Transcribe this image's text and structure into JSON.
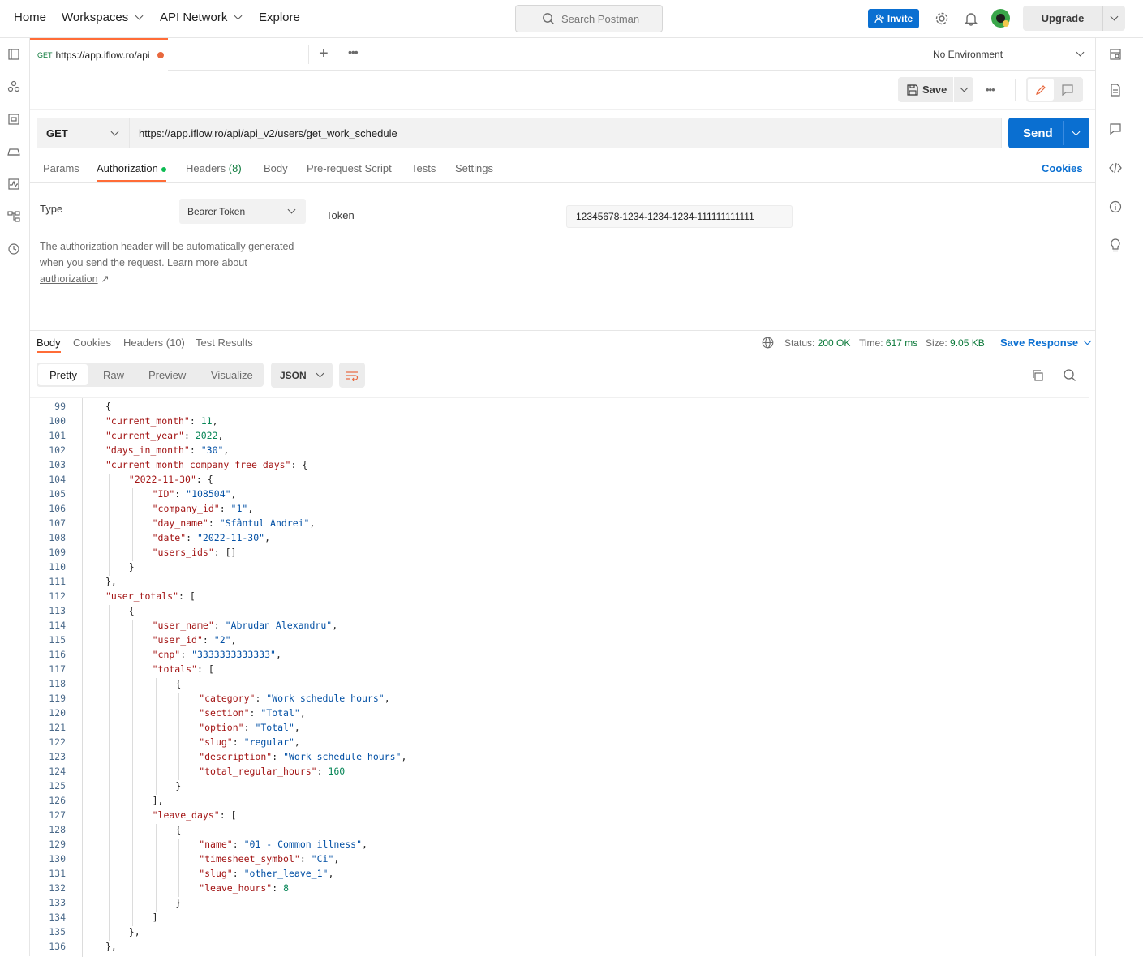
{
  "nav": {
    "home": "Home",
    "workspaces": "Workspaces",
    "api_network": "API Network",
    "explore": "Explore",
    "search_placeholder": "Search Postman",
    "invite": "Invite",
    "upgrade": "Upgrade"
  },
  "tab": {
    "method": "GET",
    "title": "https://app.iflow.ro/api",
    "environment": "No Environment"
  },
  "toolbar": {
    "save": "Save"
  },
  "request": {
    "method": "GET",
    "url": "https://app.iflow.ro/api/api_v2/users/get_work_schedule",
    "send": "Send"
  },
  "request_tabs": {
    "params": "Params",
    "authorization": "Authorization",
    "headers": "Headers",
    "headers_count": "(8)",
    "body": "Body",
    "pre_request": "Pre-request Script",
    "tests": "Tests",
    "settings": "Settings",
    "cookies": "Cookies"
  },
  "auth": {
    "type_label": "Type",
    "type_value": "Bearer Token",
    "description": "The authorization header will be automatically generated when you send the request. Learn more about",
    "link": "authorization",
    "arrow": "↗",
    "token_label": "Token",
    "token_value": "12345678-1234-1234-1234-111111111111"
  },
  "response_tabs": {
    "body": "Body",
    "cookies": "Cookies",
    "headers": "Headers",
    "headers_count": "(10)",
    "test_results": "Test Results"
  },
  "response_meta": {
    "status_label": "Status:",
    "status_value": "200 OK",
    "time_label": "Time:",
    "time_value": "617 ms",
    "size_label": "Size:",
    "size_value": "9.05 KB",
    "save_response": "Save Response"
  },
  "view_modes": {
    "pretty": "Pretty",
    "raw": "Raw",
    "preview": "Preview",
    "visualize": "Visualize",
    "format": "JSON"
  },
  "code_lines": [
    {
      "n": "99",
      "i": 1,
      "t": [
        [
          "p",
          "{"
        ]
      ]
    },
    {
      "n": "100",
      "i": 1,
      "t": [
        [
          "k",
          "\"current_month\""
        ],
        [
          "p",
          ": "
        ],
        [
          "n",
          "11"
        ],
        [
          "p",
          ","
        ]
      ]
    },
    {
      "n": "101",
      "i": 1,
      "t": [
        [
          "k",
          "\"current_year\""
        ],
        [
          "p",
          ": "
        ],
        [
          "n",
          "2022"
        ],
        [
          "p",
          ","
        ]
      ]
    },
    {
      "n": "102",
      "i": 1,
      "t": [
        [
          "k",
          "\"days_in_month\""
        ],
        [
          "p",
          ": "
        ],
        [
          "s",
          "\"30\""
        ],
        [
          "p",
          ","
        ]
      ]
    },
    {
      "n": "103",
      "i": 1,
      "t": [
        [
          "k",
          "\"current_month_company_free_days\""
        ],
        [
          "p",
          ": {"
        ]
      ]
    },
    {
      "n": "104",
      "i": 2,
      "t": [
        [
          "k",
          "\"2022-11-30\""
        ],
        [
          "p",
          ": {"
        ]
      ]
    },
    {
      "n": "105",
      "i": 3,
      "t": [
        [
          "k",
          "\"ID\""
        ],
        [
          "p",
          ": "
        ],
        [
          "s",
          "\"108504\""
        ],
        [
          "p",
          ","
        ]
      ]
    },
    {
      "n": "106",
      "i": 3,
      "t": [
        [
          "k",
          "\"company_id\""
        ],
        [
          "p",
          ": "
        ],
        [
          "s",
          "\"1\""
        ],
        [
          "p",
          ","
        ]
      ]
    },
    {
      "n": "107",
      "i": 3,
      "t": [
        [
          "k",
          "\"day_name\""
        ],
        [
          "p",
          ": "
        ],
        [
          "s",
          "\"Sfântul Andrei\""
        ],
        [
          "p",
          ","
        ]
      ]
    },
    {
      "n": "108",
      "i": 3,
      "t": [
        [
          "k",
          "\"date\""
        ],
        [
          "p",
          ": "
        ],
        [
          "s",
          "\"2022-11-30\""
        ],
        [
          "p",
          ","
        ]
      ]
    },
    {
      "n": "109",
      "i": 3,
      "t": [
        [
          "k",
          "\"users_ids\""
        ],
        [
          "p",
          ": []"
        ]
      ]
    },
    {
      "n": "110",
      "i": 2,
      "t": [
        [
          "p",
          "}"
        ]
      ]
    },
    {
      "n": "111",
      "i": 1,
      "t": [
        [
          "p",
          "},"
        ]
      ]
    },
    {
      "n": "112",
      "i": 1,
      "t": [
        [
          "k",
          "\"user_totals\""
        ],
        [
          "p",
          ": ["
        ]
      ]
    },
    {
      "n": "113",
      "i": 2,
      "t": [
        [
          "p",
          "{"
        ]
      ]
    },
    {
      "n": "114",
      "i": 3,
      "t": [
        [
          "k",
          "\"user_name\""
        ],
        [
          "p",
          ": "
        ],
        [
          "s",
          "\"Abrudan Alexandru\""
        ],
        [
          "p",
          ","
        ]
      ]
    },
    {
      "n": "115",
      "i": 3,
      "t": [
        [
          "k",
          "\"user_id\""
        ],
        [
          "p",
          ": "
        ],
        [
          "s",
          "\"2\""
        ],
        [
          "p",
          ","
        ]
      ]
    },
    {
      "n": "116",
      "i": 3,
      "t": [
        [
          "k",
          "\"cnp\""
        ],
        [
          "p",
          ": "
        ],
        [
          "s",
          "\"3333333333333\""
        ],
        [
          "p",
          ","
        ]
      ]
    },
    {
      "n": "117",
      "i": 3,
      "t": [
        [
          "k",
          "\"totals\""
        ],
        [
          "p",
          ": ["
        ]
      ]
    },
    {
      "n": "118",
      "i": 4,
      "t": [
        [
          "p",
          "{"
        ]
      ]
    },
    {
      "n": "119",
      "i": 5,
      "t": [
        [
          "k",
          "\"category\""
        ],
        [
          "p",
          ": "
        ],
        [
          "s",
          "\"Work schedule hours\""
        ],
        [
          "p",
          ","
        ]
      ]
    },
    {
      "n": "120",
      "i": 5,
      "t": [
        [
          "k",
          "\"section\""
        ],
        [
          "p",
          ": "
        ],
        [
          "s",
          "\"Total\""
        ],
        [
          "p",
          ","
        ]
      ]
    },
    {
      "n": "121",
      "i": 5,
      "t": [
        [
          "k",
          "\"option\""
        ],
        [
          "p",
          ": "
        ],
        [
          "s",
          "\"Total\""
        ],
        [
          "p",
          ","
        ]
      ]
    },
    {
      "n": "122",
      "i": 5,
      "t": [
        [
          "k",
          "\"slug\""
        ],
        [
          "p",
          ": "
        ],
        [
          "s",
          "\"regular\""
        ],
        [
          "p",
          ","
        ]
      ]
    },
    {
      "n": "123",
      "i": 5,
      "t": [
        [
          "k",
          "\"description\""
        ],
        [
          "p",
          ": "
        ],
        [
          "s",
          "\"Work schedule hours\""
        ],
        [
          "p",
          ","
        ]
      ]
    },
    {
      "n": "124",
      "i": 5,
      "t": [
        [
          "k",
          "\"total_regular_hours\""
        ],
        [
          "p",
          ": "
        ],
        [
          "n",
          "160"
        ]
      ]
    },
    {
      "n": "125",
      "i": 4,
      "t": [
        [
          "p",
          "}"
        ]
      ]
    },
    {
      "n": "126",
      "i": 3,
      "t": [
        [
          "p",
          "],"
        ]
      ]
    },
    {
      "n": "127",
      "i": 3,
      "t": [
        [
          "k",
          "\"leave_days\""
        ],
        [
          "p",
          ": ["
        ]
      ]
    },
    {
      "n": "128",
      "i": 4,
      "t": [
        [
          "p",
          "{"
        ]
      ]
    },
    {
      "n": "129",
      "i": 5,
      "t": [
        [
          "k",
          "\"name\""
        ],
        [
          "p",
          ": "
        ],
        [
          "s",
          "\"01 - Common illness\""
        ],
        [
          "p",
          ","
        ]
      ]
    },
    {
      "n": "130",
      "i": 5,
      "t": [
        [
          "k",
          "\"timesheet_symbol\""
        ],
        [
          "p",
          ": "
        ],
        [
          "s",
          "\"Ci\""
        ],
        [
          "p",
          ","
        ]
      ]
    },
    {
      "n": "131",
      "i": 5,
      "t": [
        [
          "k",
          "\"slug\""
        ],
        [
          "p",
          ": "
        ],
        [
          "s",
          "\"other_leave_1\""
        ],
        [
          "p",
          ","
        ]
      ]
    },
    {
      "n": "132",
      "i": 5,
      "t": [
        [
          "k",
          "\"leave_hours\""
        ],
        [
          "p",
          ": "
        ],
        [
          "n",
          "8"
        ]
      ]
    },
    {
      "n": "133",
      "i": 4,
      "t": [
        [
          "p",
          "}"
        ]
      ]
    },
    {
      "n": "134",
      "i": 3,
      "t": [
        [
          "p",
          "]"
        ]
      ]
    },
    {
      "n": "135",
      "i": 2,
      "t": [
        [
          "p",
          "},"
        ]
      ]
    },
    {
      "n": "136",
      "i": 1,
      "t": [
        [
          "p",
          "},"
        ]
      ]
    }
  ]
}
